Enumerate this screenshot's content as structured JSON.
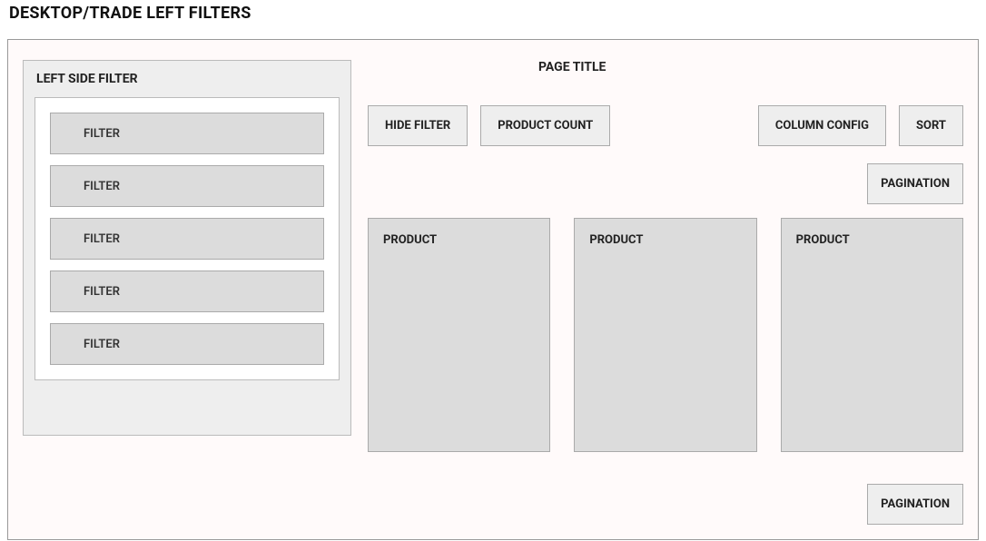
{
  "layout_title": "DESKTOP/TRADE LEFT FILTERS",
  "sidebar": {
    "title": "LEFT SIDE FILTER",
    "filters": [
      {
        "label": "FILTER"
      },
      {
        "label": "FILTER"
      },
      {
        "label": "FILTER"
      },
      {
        "label": "FILTER"
      },
      {
        "label": "FILTER"
      }
    ]
  },
  "page_title": "PAGE TITLE",
  "toolbar": {
    "hide_filter": "HIDE FILTER",
    "product_count": "PRODUCT COUNT",
    "column_config": "COLUMN CONFIG",
    "sort": "SORT"
  },
  "pagination": {
    "top": "PAGINATION",
    "bottom": "PAGINATION"
  },
  "products": [
    {
      "label": "PRODUCT"
    },
    {
      "label": "PRODUCT"
    },
    {
      "label": "PRODUCT"
    }
  ]
}
